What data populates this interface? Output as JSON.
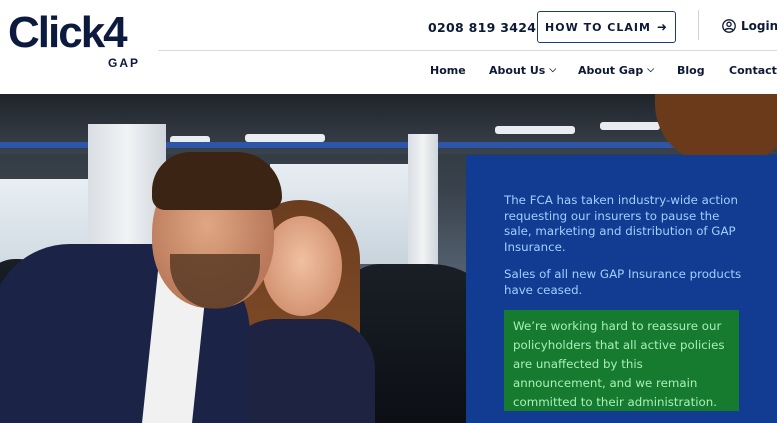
{
  "brand": {
    "logo_main": "Click4",
    "logo_sub": "GAP"
  },
  "header": {
    "phone": "0208 819 3424",
    "claim_button": "HOW TO CLAIM",
    "login": "Login"
  },
  "nav": {
    "items": [
      {
        "label": "Home",
        "has_dropdown": false
      },
      {
        "label": "About Us",
        "has_dropdown": true
      },
      {
        "label": "About Gap",
        "has_dropdown": true
      },
      {
        "label": "Blog",
        "has_dropdown": false
      },
      {
        "label": "Contact",
        "has_dropdown": false
      }
    ]
  },
  "notice": {
    "paragraph1": "The FCA has taken industry-wide action requesting our insurers to pause the sale, marketing and distribution of GAP Insurance.",
    "paragraph2": "Sales of all new GAP Insurance products have ceased.",
    "highlight": "We’re working hard to reassure our policyholders that all active policies are unaffected by this announcement, and we remain committed to their administration."
  },
  "colors": {
    "brand_navy": "#0b1a3e",
    "notice_blue": "#123c91",
    "notice_text": "#9fd0ff",
    "highlight_green": "#167a2f",
    "highlight_text": "#a8f0b8"
  },
  "icons": {
    "claim_arrow": "arrow-right-icon",
    "login": "user-circle-icon",
    "dropdown": "chevron-down-icon"
  }
}
